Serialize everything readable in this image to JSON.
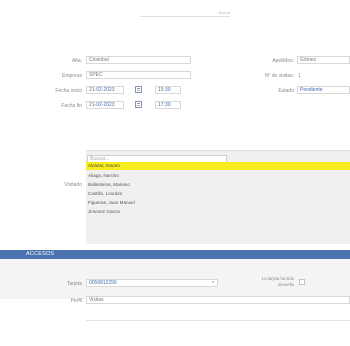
{
  "header": {
    "title": "Nueva"
  },
  "form": {
    "nombre_label": "Alta:",
    "nombre_value": "Cristobal",
    "apellidos_label": "Apellidos:",
    "apellidos_value": "Gómez",
    "empresa_label": "Empresa",
    "empresa_value": "SPEC",
    "num_visitas_label": "Nº de visitas:",
    "num_visitas_value": "1",
    "fecha_inicio_label": "Fecha inicio",
    "fecha_inicio_value": "21-02-2023",
    "hora_inicio_value": "15:30",
    "estado_label": "Estado",
    "estado_value": "Pendiente",
    "fecha_fin_label": "Fecha fin",
    "fecha_fin_value": "21-02-2023",
    "hora_fin_value": "17:30"
  },
  "visitado": {
    "label": "Visitado",
    "search_placeholder": "Buscar...",
    "items": [
      "Alcázar, Aracen",
      "Aliaga, Narciso",
      "Ballesteros, Mariano",
      "Castillo, Lourdes",
      "Figueras, Juan Manuel",
      "Jimenez Garcia"
    ],
    "selected_index": 0
  },
  "accesos": {
    "section_title": "ACCESOS",
    "tarjeta_label": "Tarjeta",
    "tarjeta_value": "0056812256",
    "tarjeta_devuelta_label": "La tarjeta ha sido devuelta",
    "perfil_label": "Perfil",
    "perfil_value": "Visitas"
  },
  "colors": {
    "accent": "#4b73b0",
    "selected_row": "#f6ec1e"
  },
  "icons": {
    "calendar": "calendar-icon",
    "dropdown": "chevron-down-icon"
  }
}
